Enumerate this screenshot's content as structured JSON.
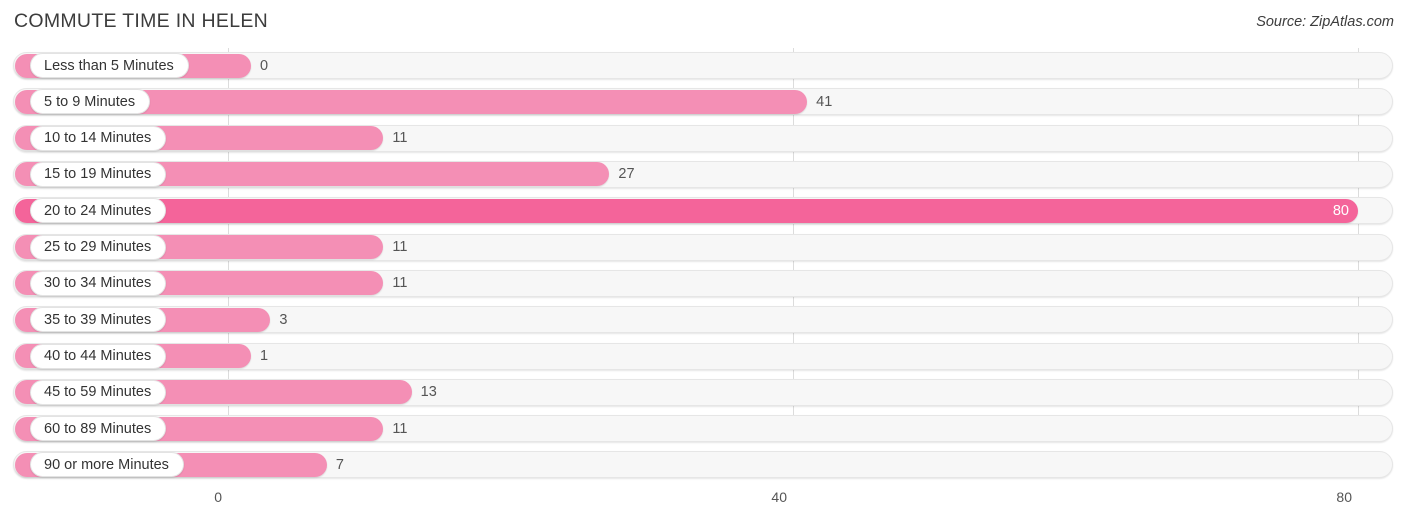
{
  "header": {
    "title": "COMMUTE TIME IN HELEN",
    "source": "Source: ZipAtlas.com"
  },
  "colors": {
    "bar": "#f48fb5",
    "bar_max": "#f4649a",
    "track": "#f7f7f7",
    "gridline": "#dcdcdc",
    "text": "#3c3c3c"
  },
  "chart_data": {
    "type": "bar",
    "orientation": "horizontal",
    "title": "COMMUTE TIME IN HELEN",
    "source": "Source: ZipAtlas.com",
    "xlabel": "",
    "ylabel": "",
    "xlim": [
      0,
      80
    ],
    "ticks": [
      "0",
      "40",
      "80"
    ],
    "tick_values": [
      0,
      40,
      80
    ],
    "grid": true,
    "legend": null,
    "max_value": 80,
    "categories": [
      "Less than 5 Minutes",
      "5 to 9 Minutes",
      "10 to 14 Minutes",
      "15 to 19 Minutes",
      "20 to 24 Minutes",
      "25 to 29 Minutes",
      "30 to 34 Minutes",
      "35 to 39 Minutes",
      "40 to 44 Minutes",
      "45 to 59 Minutes",
      "60 to 89 Minutes",
      "90 or more Minutes"
    ],
    "values": [
      0,
      41,
      11,
      27,
      80,
      11,
      11,
      3,
      1,
      13,
      11,
      7
    ],
    "value_labels": [
      "0",
      "41",
      "11",
      "27",
      "80",
      "11",
      "11",
      "3",
      "1",
      "13",
      "11",
      "7"
    ]
  }
}
